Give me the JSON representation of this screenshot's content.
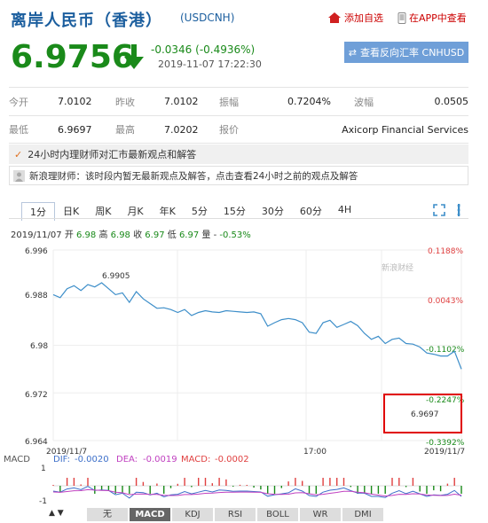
{
  "header": {
    "title": "离岸人民币（香港）",
    "code": "(USDCNH)",
    "favorite_label": "添加自选",
    "app_label": "在APP中查看",
    "price": "6.9756",
    "change": "-0.0346 (-0.4936%)",
    "time": "2019-11-07 17:22:30",
    "reverse_button": "查看反向汇率 CNHUSD"
  },
  "quote_rows": [
    [
      {
        "label": "今开",
        "value": "7.0102"
      },
      {
        "label": "昨收",
        "value": "7.0102"
      },
      {
        "label": "振幅",
        "value": "0.7204%"
      },
      {
        "label": "波幅",
        "value": "0.0505"
      }
    ],
    [
      {
        "label": "最低",
        "value": "6.9697"
      },
      {
        "label": "最高",
        "value": "7.0202"
      },
      {
        "label": "报价",
        "value": "Axicorp Financial Services"
      },
      {
        "label": "",
        "value": ""
      }
    ]
  ],
  "news": {
    "banner": "24小时内理财师对汇市最新观点和解答",
    "notice": "新浪理财师：该时段内暂无最新观点及解答，点击查看24小时之前的观点及解答"
  },
  "tabs": [
    "1分",
    "日K",
    "周K",
    "月K",
    "年K",
    "5分",
    "15分",
    "30分",
    "60分",
    "4H"
  ],
  "active_tab": "1分",
  "ohlc": {
    "date": "2019/11/07",
    "open_label": "开",
    "open": "6.98",
    "high_label": "高",
    "high": "6.98",
    "close_label": "收",
    "close": "6.97",
    "low_label": "低",
    "low": "6.97",
    "volume_label": "量",
    "volume": "-",
    "pct": "-0.53%"
  },
  "chart_data": {
    "type": "line",
    "yticks": [
      "6.996",
      "6.988",
      "6.98",
      "6.972",
      "6.964"
    ],
    "ylim": [
      6.964,
      6.996
    ],
    "pct_ticks": [
      "0.1188%",
      "0.0043%",
      "-0.1102%",
      "-0.2247%",
      "-0.3392%"
    ],
    "xticks": [
      "2019/11/7",
      "17:00",
      "2019/11/7"
    ],
    "watermark": "新浪财经",
    "peak_label": "6.9905",
    "last_label": "6.9697",
    "x": [
      0,
      1,
      2,
      3,
      4,
      5,
      6,
      7,
      8,
      9,
      10,
      11,
      12,
      13,
      14,
      15,
      16,
      17,
      18,
      19,
      20,
      21,
      22,
      23,
      24,
      25,
      26,
      27,
      28,
      29,
      30,
      31,
      32,
      33,
      34,
      35,
      36,
      37,
      38,
      39,
      40,
      41,
      42,
      43,
      44,
      45,
      46,
      47,
      48,
      49,
      50,
      51,
      52,
      53,
      54,
      55,
      56,
      57,
      58,
      59
    ],
    "values": [
      6.9885,
      6.988,
      6.9895,
      6.99,
      6.9892,
      6.9902,
      6.9898,
      6.9905,
      6.9895,
      6.9885,
      6.9888,
      6.9872,
      6.989,
      6.9878,
      6.987,
      6.9862,
      6.9863,
      6.986,
      6.9855,
      6.986,
      6.985,
      6.9855,
      6.9858,
      6.9856,
      6.9855,
      6.9858,
      6.9857,
      6.9856,
      6.9855,
      6.9856,
      6.9853,
      6.9832,
      6.9838,
      6.9843,
      6.9845,
      6.9843,
      6.9838,
      6.9822,
      6.982,
      6.9838,
      6.9842,
      6.983,
      6.9835,
      6.984,
      6.9833,
      6.982,
      6.981,
      6.9815,
      6.9803,
      6.981,
      6.9812,
      6.9803,
      6.9802,
      6.9797,
      6.9787,
      6.9785,
      6.9782,
      6.9782,
      6.979,
      6.976
    ],
    "macd": {
      "label": "MACD",
      "dif_label": "DIF:",
      "dif": "-0.0020",
      "dea_label": "DEA:",
      "dea": "-0.0019",
      "macd_label": "MACD:",
      "macd_value": "-0.0002",
      "yticks": [
        "1",
        "-1"
      ]
    }
  },
  "bottom_tabs": [
    "无",
    "MACD",
    "KDJ",
    "RSI",
    "BOLL",
    "WR",
    "DMI"
  ],
  "active_bottom_tab": "MACD",
  "colors": {
    "up": "#e04040",
    "down": "#1a8a1a",
    "line": "#3d8ec9",
    "accent": "#6f9fd8",
    "highlight_box": "#e00000"
  }
}
